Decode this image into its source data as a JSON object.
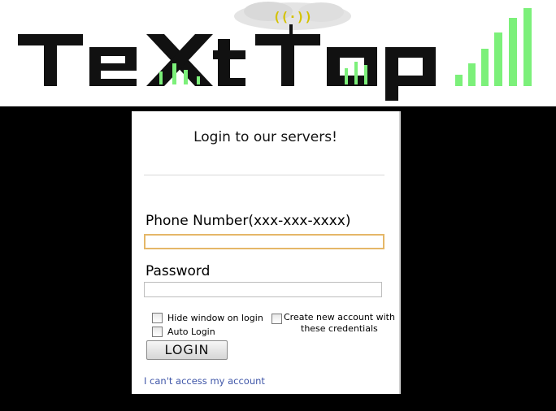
{
  "brand": {
    "logo_text": "TeXtTop"
  },
  "login": {
    "title": "Login to our servers!",
    "phone_label": "Phone Number(xxx-xxx-xxxx)",
    "phone_value": "",
    "password_label": "Password",
    "password_value": "",
    "hide_window_label": "Hide window on login",
    "hide_window_checked": false,
    "auto_login_label": "Auto Login",
    "auto_login_checked": false,
    "create_account_label_line1": "Create new account with",
    "create_account_label_line2": "these credentials",
    "create_account_checked": false,
    "login_button": "LOGIN",
    "cant_access_link": "I can't access my account"
  },
  "colors": {
    "logo_black": "#111111",
    "logo_green": "#7cf07a",
    "input_focus_border": "#e5b768",
    "link": "#3f56a8"
  },
  "icons": [
    "signal-bars-icon",
    "cloud-signal-icon"
  ]
}
